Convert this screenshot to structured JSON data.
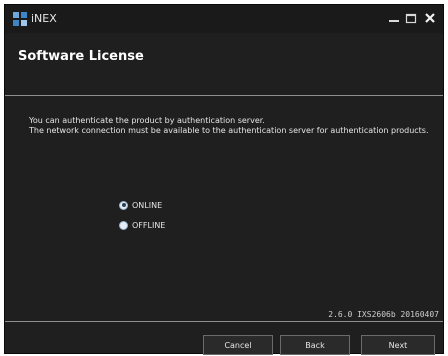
{
  "window": {
    "app_name": "iNEX",
    "controls": {
      "minimize": "minimize-icon",
      "maximize": "maximize-icon",
      "close": "close-icon"
    }
  },
  "header": {
    "title": "Software License"
  },
  "description": {
    "line1": "You can authenticate the product by authentication server.",
    "line2": "The network connection must be available to the authentication server for authentication products."
  },
  "auth_options": {
    "selected": "ONLINE",
    "online_label": "ONLINE",
    "offline_label": "OFFLINE"
  },
  "version": "2.6.0 IXS2606b 20160407",
  "buttons": {
    "cancel": "Cancel",
    "back": "Back",
    "next": "Next"
  },
  "colors": {
    "background": "#1f1f1f",
    "separator": "#8f8f8f",
    "text": "#e6e6e6"
  }
}
